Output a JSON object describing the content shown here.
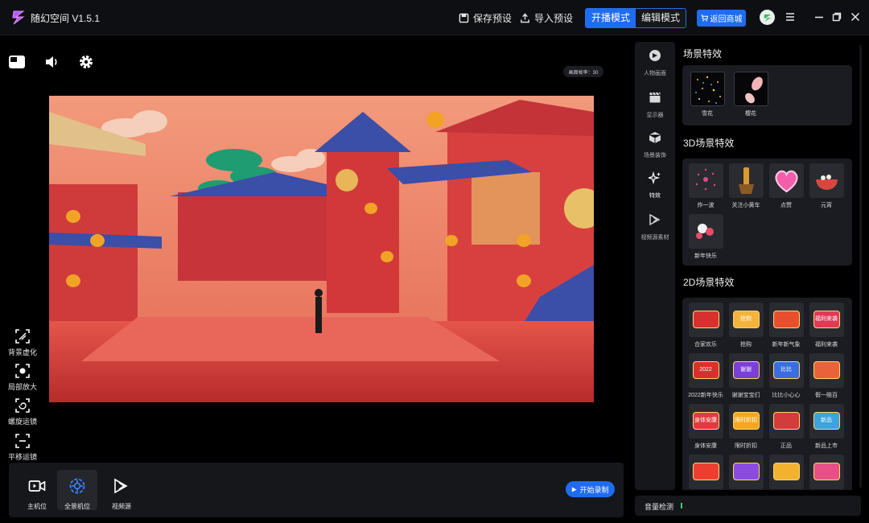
{
  "app": {
    "title": "随幻空间 V1.5.1"
  },
  "toolbar": {
    "save_preset": "保存预设",
    "import_preset": "导入预设",
    "mode_live": "开播模式",
    "mode_edit": "编辑模式",
    "shop": "返回商城"
  },
  "stage": {
    "fps_label": "画面帧率：30"
  },
  "camera_tools": [
    {
      "label": "背景虚化",
      "icon": "blur-frame-icon"
    },
    {
      "label": "局部放大",
      "icon": "zoom-frame-icon"
    },
    {
      "label": "螺旋运镜",
      "icon": "spiral-camera-icon"
    },
    {
      "label": "平移运镜",
      "icon": "pan-camera-icon"
    }
  ],
  "bottom_bar": {
    "items": [
      {
        "label": "主机位",
        "icon": "video-camera-icon"
      },
      {
        "label": "全景机位",
        "icon": "panorama-camera-icon"
      },
      {
        "label": "视频源",
        "icon": "video-source-icon"
      }
    ],
    "record": "开始录制"
  },
  "side_nav": [
    {
      "label": "人物画面",
      "icon": "person-icon"
    },
    {
      "label": "显示器",
      "icon": "clapper-icon"
    },
    {
      "label": "场景装饰",
      "icon": "cube-icon"
    },
    {
      "label": "特效",
      "icon": "sparkle-icon"
    },
    {
      "label": "视频源素材",
      "icon": "video-source-icon"
    }
  ],
  "panel": {
    "scene_fx_title": "场景特效",
    "scene_fx": [
      "雪花",
      "樱花"
    ],
    "fx3d_title": "3D场景特效",
    "fx3d": [
      "炸一波",
      "关注小黄车",
      "点赞",
      "元宵",
      "新年快乐"
    ],
    "fx2d_title": "2D场景特效",
    "fx2d": [
      "合家欢乐",
      "抢购",
      "新年新气象",
      "福利来袭",
      "2022新年快乐",
      "谢谢宝宝们",
      "比比小心心",
      "假一赔百",
      "身体安康",
      "限时折扣",
      "正品",
      "新品上市",
      "",
      "",
      "",
      ""
    ],
    "fx2d_thumb_text": [
      "",
      "抢购",
      "",
      "福利来袭",
      "2022",
      "谢谢",
      "比比",
      "",
      "身体安康",
      "限时折扣",
      "",
      "新品",
      "",
      "",
      "",
      ""
    ]
  },
  "volume": {
    "label": "音量检测"
  },
  "colors": {
    "accent": "#1e6cf0",
    "panel": "#1b1c21",
    "meter": "#2fd36b"
  }
}
